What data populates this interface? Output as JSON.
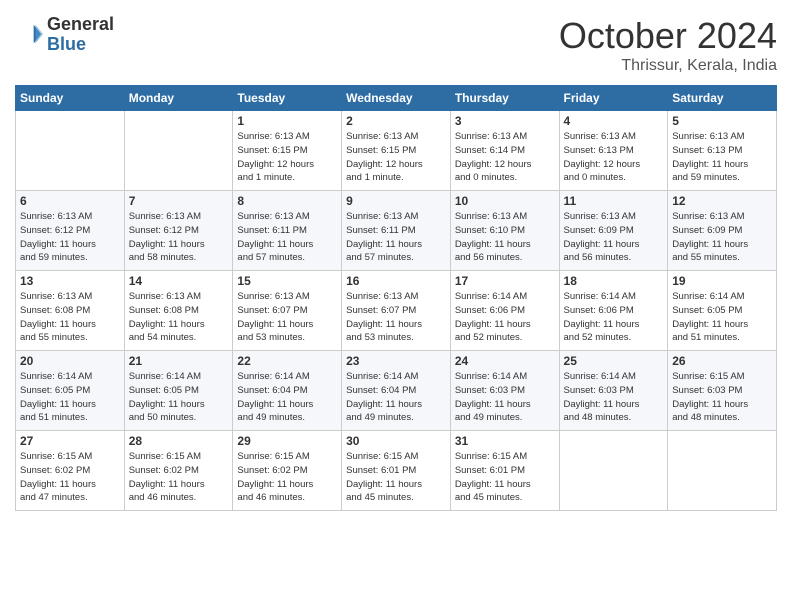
{
  "header": {
    "logo_general": "General",
    "logo_blue": "Blue",
    "month_title": "October 2024",
    "location": "Thrissur, Kerala, India"
  },
  "columns": [
    "Sunday",
    "Monday",
    "Tuesday",
    "Wednesday",
    "Thursday",
    "Friday",
    "Saturday"
  ],
  "weeks": [
    [
      {
        "day": "",
        "info": ""
      },
      {
        "day": "",
        "info": ""
      },
      {
        "day": "1",
        "info": "Sunrise: 6:13 AM\nSunset: 6:15 PM\nDaylight: 12 hours\nand 1 minute."
      },
      {
        "day": "2",
        "info": "Sunrise: 6:13 AM\nSunset: 6:15 PM\nDaylight: 12 hours\nand 1 minute."
      },
      {
        "day": "3",
        "info": "Sunrise: 6:13 AM\nSunset: 6:14 PM\nDaylight: 12 hours\nand 0 minutes."
      },
      {
        "day": "4",
        "info": "Sunrise: 6:13 AM\nSunset: 6:13 PM\nDaylight: 12 hours\nand 0 minutes."
      },
      {
        "day": "5",
        "info": "Sunrise: 6:13 AM\nSunset: 6:13 PM\nDaylight: 11 hours\nand 59 minutes."
      }
    ],
    [
      {
        "day": "6",
        "info": "Sunrise: 6:13 AM\nSunset: 6:12 PM\nDaylight: 11 hours\nand 59 minutes."
      },
      {
        "day": "7",
        "info": "Sunrise: 6:13 AM\nSunset: 6:12 PM\nDaylight: 11 hours\nand 58 minutes."
      },
      {
        "day": "8",
        "info": "Sunrise: 6:13 AM\nSunset: 6:11 PM\nDaylight: 11 hours\nand 57 minutes."
      },
      {
        "day": "9",
        "info": "Sunrise: 6:13 AM\nSunset: 6:11 PM\nDaylight: 11 hours\nand 57 minutes."
      },
      {
        "day": "10",
        "info": "Sunrise: 6:13 AM\nSunset: 6:10 PM\nDaylight: 11 hours\nand 56 minutes."
      },
      {
        "day": "11",
        "info": "Sunrise: 6:13 AM\nSunset: 6:09 PM\nDaylight: 11 hours\nand 56 minutes."
      },
      {
        "day": "12",
        "info": "Sunrise: 6:13 AM\nSunset: 6:09 PM\nDaylight: 11 hours\nand 55 minutes."
      }
    ],
    [
      {
        "day": "13",
        "info": "Sunrise: 6:13 AM\nSunset: 6:08 PM\nDaylight: 11 hours\nand 55 minutes."
      },
      {
        "day": "14",
        "info": "Sunrise: 6:13 AM\nSunset: 6:08 PM\nDaylight: 11 hours\nand 54 minutes."
      },
      {
        "day": "15",
        "info": "Sunrise: 6:13 AM\nSunset: 6:07 PM\nDaylight: 11 hours\nand 53 minutes."
      },
      {
        "day": "16",
        "info": "Sunrise: 6:13 AM\nSunset: 6:07 PM\nDaylight: 11 hours\nand 53 minutes."
      },
      {
        "day": "17",
        "info": "Sunrise: 6:14 AM\nSunset: 6:06 PM\nDaylight: 11 hours\nand 52 minutes."
      },
      {
        "day": "18",
        "info": "Sunrise: 6:14 AM\nSunset: 6:06 PM\nDaylight: 11 hours\nand 52 minutes."
      },
      {
        "day": "19",
        "info": "Sunrise: 6:14 AM\nSunset: 6:05 PM\nDaylight: 11 hours\nand 51 minutes."
      }
    ],
    [
      {
        "day": "20",
        "info": "Sunrise: 6:14 AM\nSunset: 6:05 PM\nDaylight: 11 hours\nand 51 minutes."
      },
      {
        "day": "21",
        "info": "Sunrise: 6:14 AM\nSunset: 6:05 PM\nDaylight: 11 hours\nand 50 minutes."
      },
      {
        "day": "22",
        "info": "Sunrise: 6:14 AM\nSunset: 6:04 PM\nDaylight: 11 hours\nand 49 minutes."
      },
      {
        "day": "23",
        "info": "Sunrise: 6:14 AM\nSunset: 6:04 PM\nDaylight: 11 hours\nand 49 minutes."
      },
      {
        "day": "24",
        "info": "Sunrise: 6:14 AM\nSunset: 6:03 PM\nDaylight: 11 hours\nand 49 minutes."
      },
      {
        "day": "25",
        "info": "Sunrise: 6:14 AM\nSunset: 6:03 PM\nDaylight: 11 hours\nand 48 minutes."
      },
      {
        "day": "26",
        "info": "Sunrise: 6:15 AM\nSunset: 6:03 PM\nDaylight: 11 hours\nand 48 minutes."
      }
    ],
    [
      {
        "day": "27",
        "info": "Sunrise: 6:15 AM\nSunset: 6:02 PM\nDaylight: 11 hours\nand 47 minutes."
      },
      {
        "day": "28",
        "info": "Sunrise: 6:15 AM\nSunset: 6:02 PM\nDaylight: 11 hours\nand 46 minutes."
      },
      {
        "day": "29",
        "info": "Sunrise: 6:15 AM\nSunset: 6:02 PM\nDaylight: 11 hours\nand 46 minutes."
      },
      {
        "day": "30",
        "info": "Sunrise: 6:15 AM\nSunset: 6:01 PM\nDaylight: 11 hours\nand 45 minutes."
      },
      {
        "day": "31",
        "info": "Sunrise: 6:15 AM\nSunset: 6:01 PM\nDaylight: 11 hours\nand 45 minutes."
      },
      {
        "day": "",
        "info": ""
      },
      {
        "day": "",
        "info": ""
      }
    ]
  ]
}
